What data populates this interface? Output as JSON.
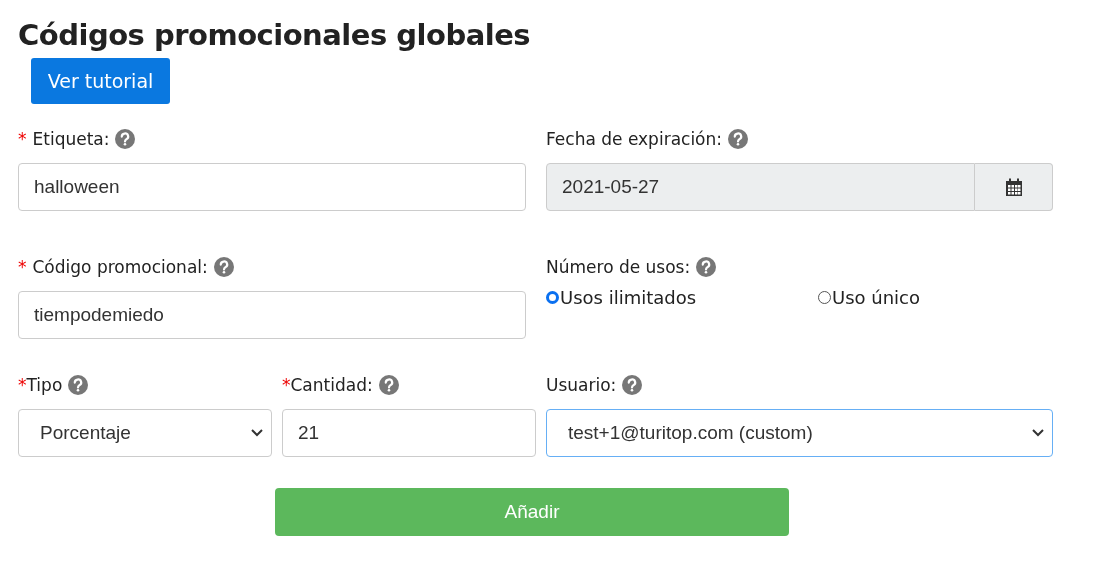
{
  "title": "Códigos promocionales globales",
  "tutorial_button": "Ver tutorial",
  "rows": [
    [
      {
        "kind": "text",
        "marker": "*",
        "label": "Etiqueta:",
        "help": true,
        "value": "halloween"
      },
      {
        "kind": "date",
        "label": "Fecha de expiración:",
        "help": true,
        "value": "2021-05-27",
        "disabled": true
      }
    ],
    [
      {
        "kind": "text",
        "marker": "*",
        "label": "Código promocional:",
        "help": true,
        "value": "tiempodemiedo"
      },
      {
        "kind": "radio",
        "label": "Número de usos:",
        "help": true,
        "options": [
          {
            "label": "Usos ilimitados",
            "selected": true
          },
          {
            "label": "Uso único",
            "selected": false
          }
        ]
      }
    ],
    [
      {
        "kind": "select",
        "marker": "*",
        "label": "Tipo",
        "help": true,
        "value": "Porcentaje",
        "focused": false
      },
      {
        "kind": "text",
        "marker": "*",
        "label": "Cantidad:",
        "help": true,
        "value": "21"
      },
      {
        "kind": "select",
        "label": "Usuario:",
        "help": true,
        "value": "test+1@turitop.com (custom)",
        "focused": true
      }
    ]
  ],
  "submit_button": "Añadir"
}
